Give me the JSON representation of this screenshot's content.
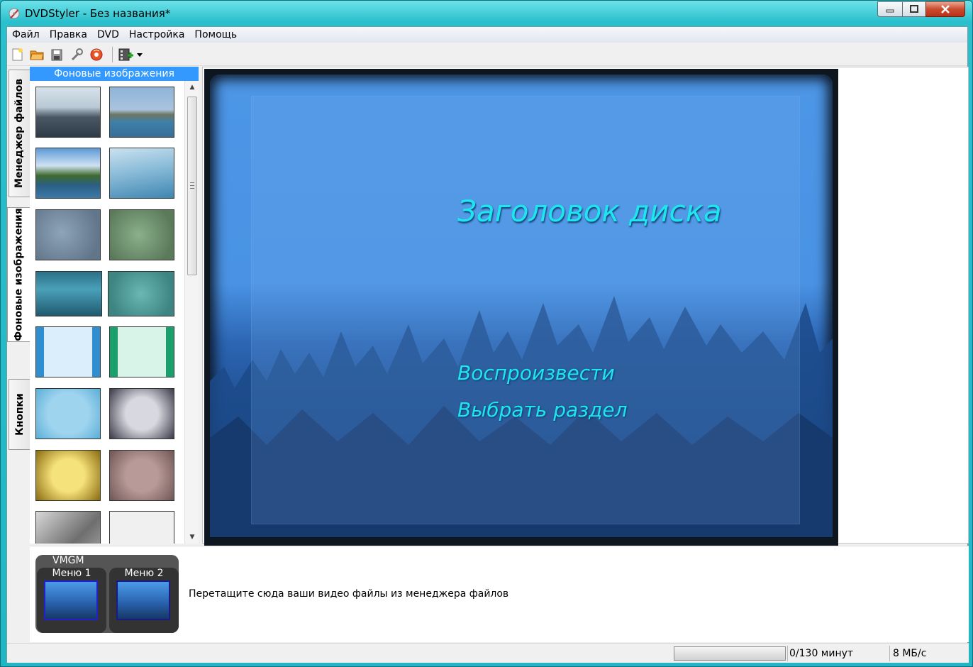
{
  "window": {
    "title": "DVDStyler - Без названия*"
  },
  "menubar": {
    "items": [
      "Файл",
      "Правка",
      "DVD",
      "Настройка",
      "Помощь"
    ]
  },
  "toolbar": {
    "buttons": [
      "new-icon",
      "open-icon",
      "save-icon",
      "settings-icon",
      "burn-icon",
      "add-file-icon",
      "dropdown-arrow-icon"
    ]
  },
  "side_tabs": {
    "file_manager": "Менеджер файлов",
    "backgrounds": "Фоновые изображения",
    "buttons": "Кнопки"
  },
  "backgrounds_panel": {
    "header": "Фоновые изображения"
  },
  "menu_preview": {
    "title": "Заголовок диска",
    "play": "Воспроизвести",
    "chapter": "Выбрать раздел"
  },
  "titleset": {
    "vmgm_label": "VMGM",
    "menu1": "Меню 1",
    "menu2": "Меню 2",
    "drop_hint": "Перетащите сюда ваши видео файлы из менеджера файлов"
  },
  "statusbar": {
    "progress_fraction": 0,
    "duration": "0/130 минут",
    "bitrate": "8 МБ/с"
  },
  "colors": {
    "window_frame": "#22b6c4",
    "panel_header": "#3399ff",
    "menu_text": "#1ee6ef"
  }
}
